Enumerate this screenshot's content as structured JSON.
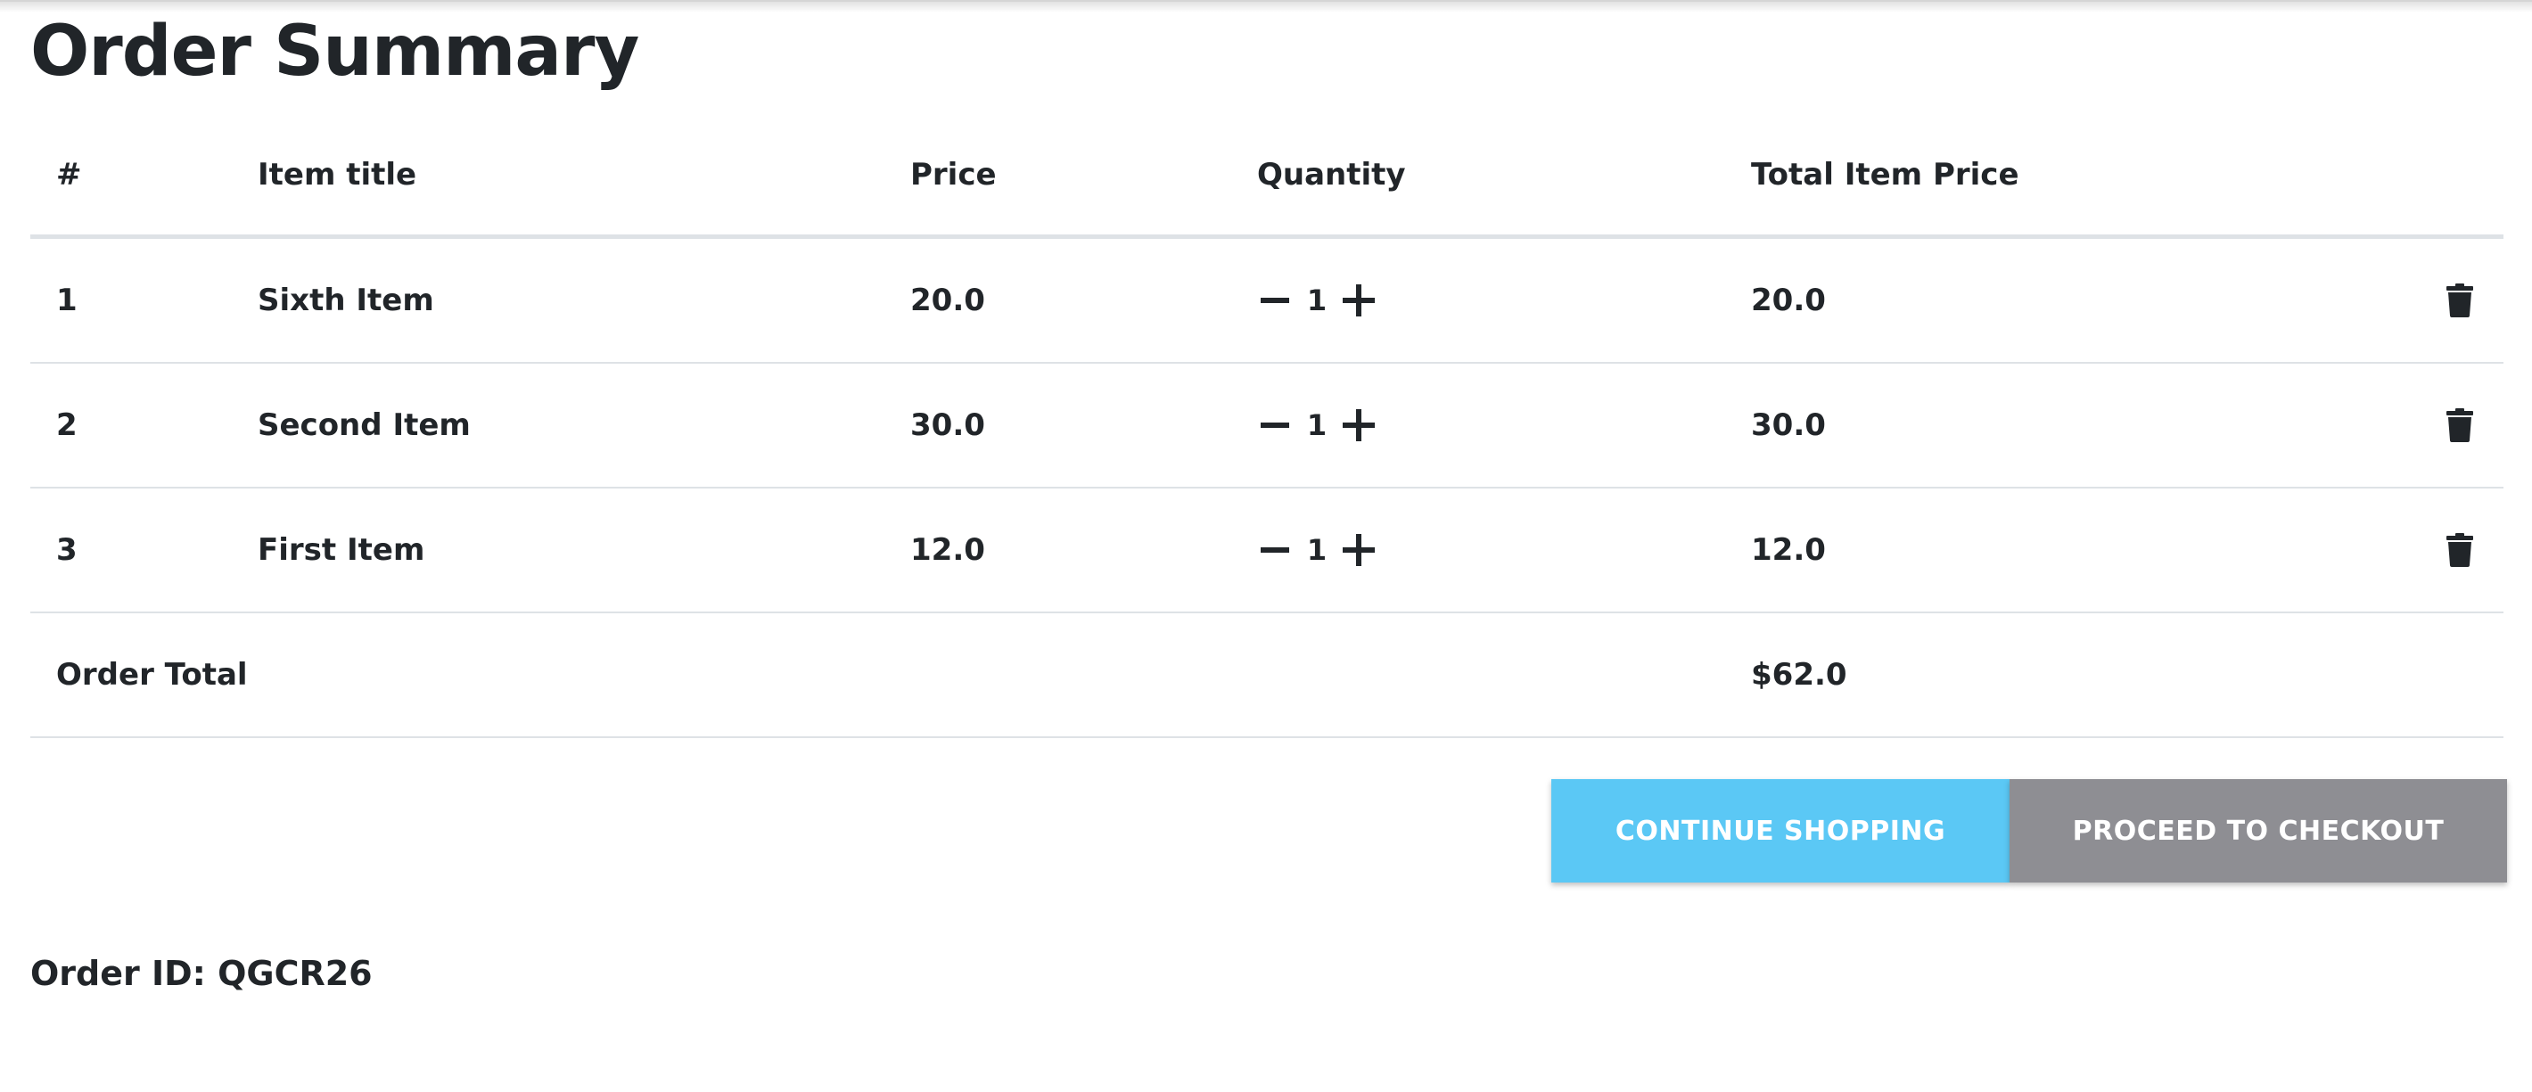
{
  "page": {
    "title": "Order Summary",
    "order_id_text": "Order ID: QGCR26"
  },
  "table": {
    "headers": {
      "num": "#",
      "title": "Item title",
      "price": "Price",
      "quantity": "Quantity",
      "total": "Total Item Price"
    },
    "rows": [
      {
        "num": "1",
        "title": "Sixth Item",
        "price": "20.0",
        "quantity": "1",
        "total": "20.0"
      },
      {
        "num": "2",
        "title": "Second Item",
        "price": "30.0",
        "quantity": "1",
        "total": "30.0"
      },
      {
        "num": "3",
        "title": "First Item",
        "price": "12.0",
        "quantity": "1",
        "total": "12.0"
      }
    ],
    "order_total_label": "Order Total",
    "order_total_value": "$62.0"
  },
  "actions": {
    "continue_label": "CONTINUE SHOPPING",
    "checkout_label": "PROCEED TO CHECKOUT"
  },
  "icons": {
    "decrement": "minus-icon",
    "increment": "plus-icon",
    "delete": "trash-icon"
  },
  "colors": {
    "continue_button": "#5bc8f5",
    "checkout_button": "#8e8e93",
    "text": "#212529",
    "row_border": "#dee2e6"
  }
}
